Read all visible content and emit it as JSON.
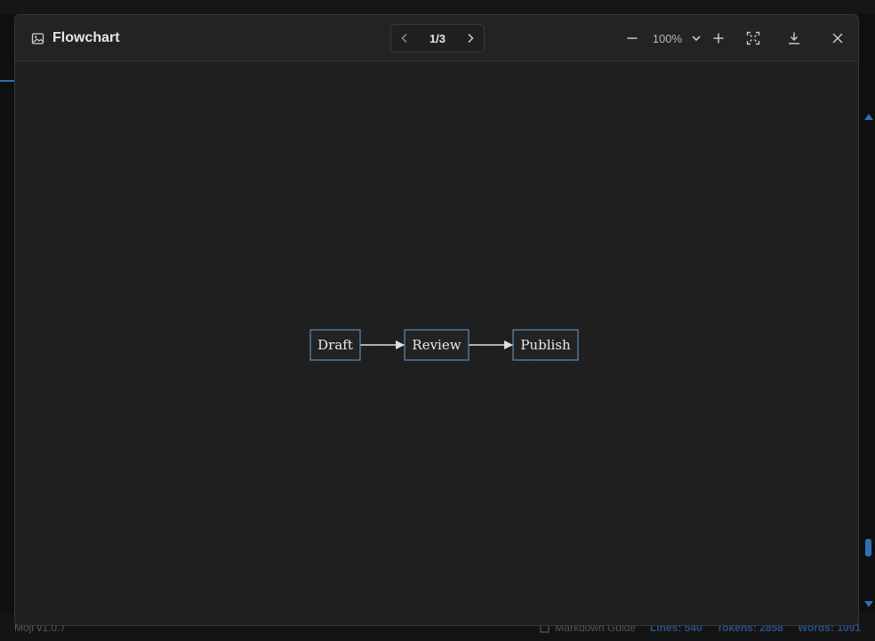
{
  "modal": {
    "title": "Flowchart",
    "title_icon": "image-icon",
    "pager": {
      "label": "1/3"
    },
    "zoom": {
      "value": "100%"
    }
  },
  "diagram": {
    "type": "flowchart",
    "nodes": [
      "Draft",
      "Review",
      "Publish"
    ],
    "edges": [
      [
        "Draft",
        "Review"
      ],
      [
        "Review",
        "Publish"
      ]
    ],
    "colors": {
      "node_border": "#5d8db6",
      "node_fill": "#232323",
      "edge": "#e0e0e0",
      "text": "#e8e8e8"
    }
  },
  "background": {
    "status_left": "Moji v1.0.7",
    "guide_label": "Markdown Guide",
    "lines": "Lines: 540",
    "tokens": "Tokens: 2858",
    "words": "Words: 1091"
  },
  "colors": {
    "accent": "#2f6fb3",
    "modal_bg": "#1f1f1f",
    "page_bg": "#0f0f0f"
  }
}
